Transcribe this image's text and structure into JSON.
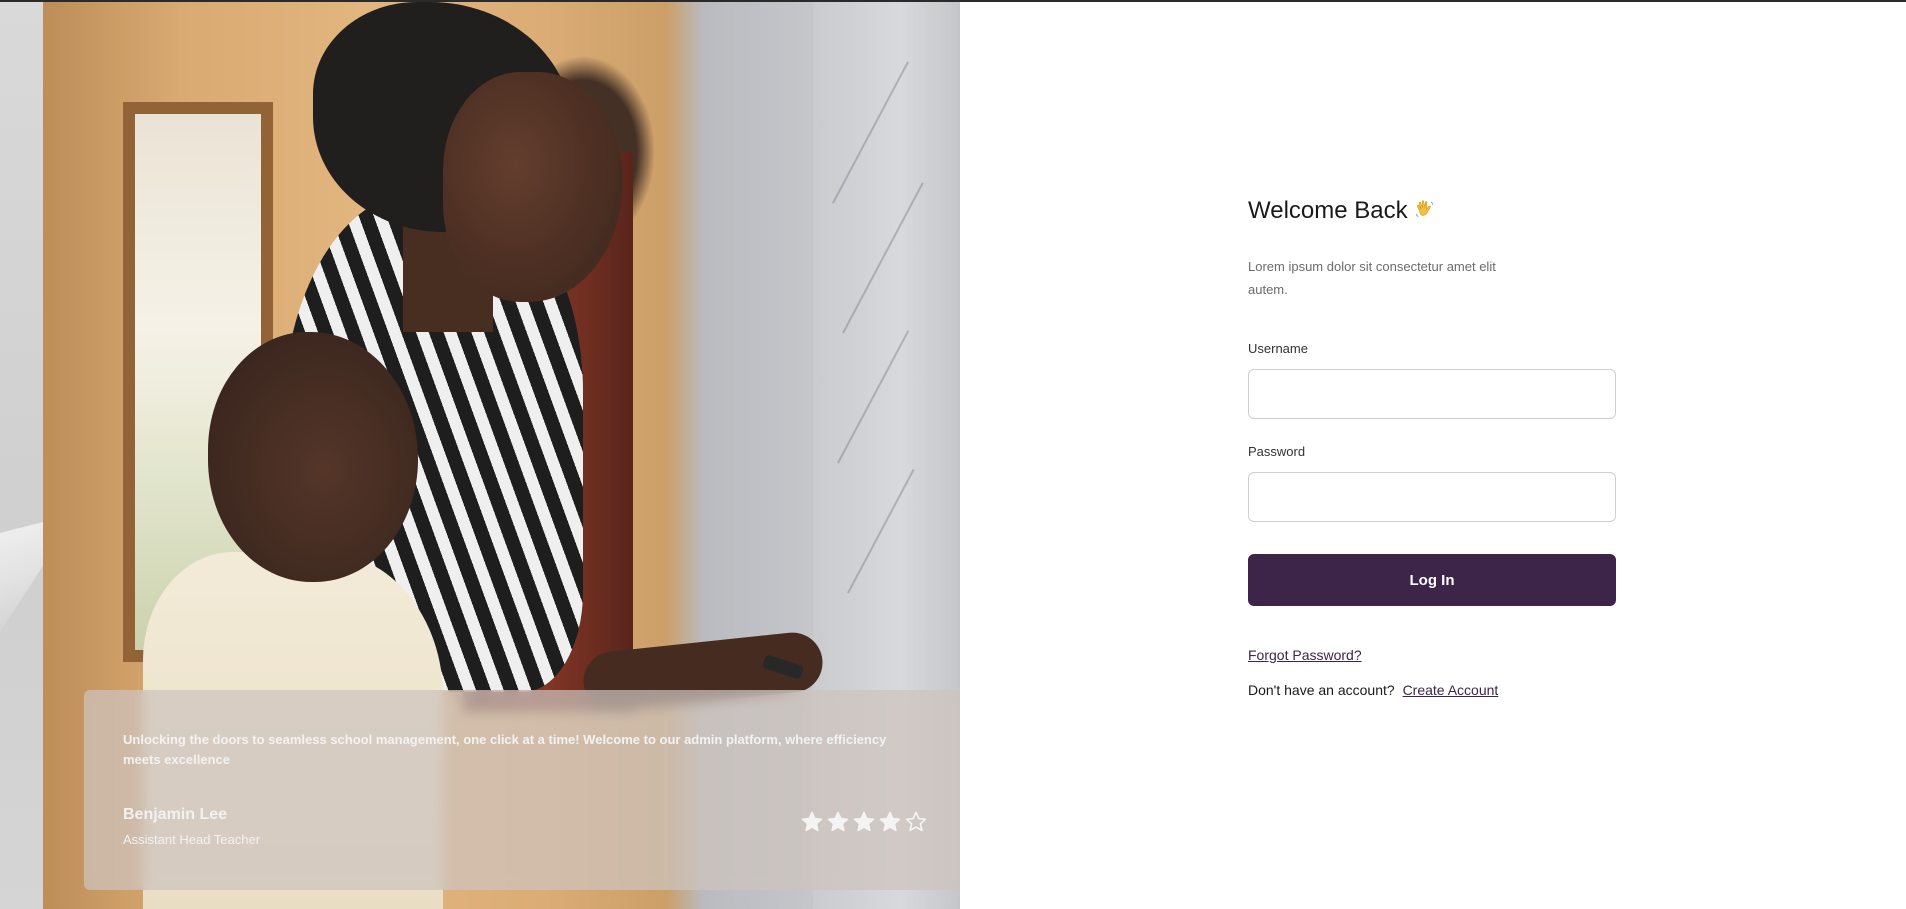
{
  "hero": {
    "testimonial": {
      "quote": "Unlocking the doors to seamless school management, one click at a time! Welcome to our admin platform, where efficiency meets excellence",
      "author": "Benjamin Lee",
      "role": "Assistant Head Teacher",
      "rating": 4,
      "rating_max": 5
    }
  },
  "login": {
    "title": "Welcome Back",
    "title_icon": "waving-hand-icon",
    "subtitle": "Lorem ipsum dolor sit consectetur amet elit autem.",
    "username_label": "Username",
    "username_value": "",
    "password_label": "Password",
    "password_value": "",
    "submit_label": "Log In",
    "forgot_label": "Forgot Password?",
    "signup_prompt": "Don't have an account?",
    "signup_label": "Create Account"
  },
  "colors": {
    "primary": "#3d2549",
    "text": "#1a1a1a",
    "muted": "#6b6b6b",
    "input_border": "#cfcfcf"
  }
}
